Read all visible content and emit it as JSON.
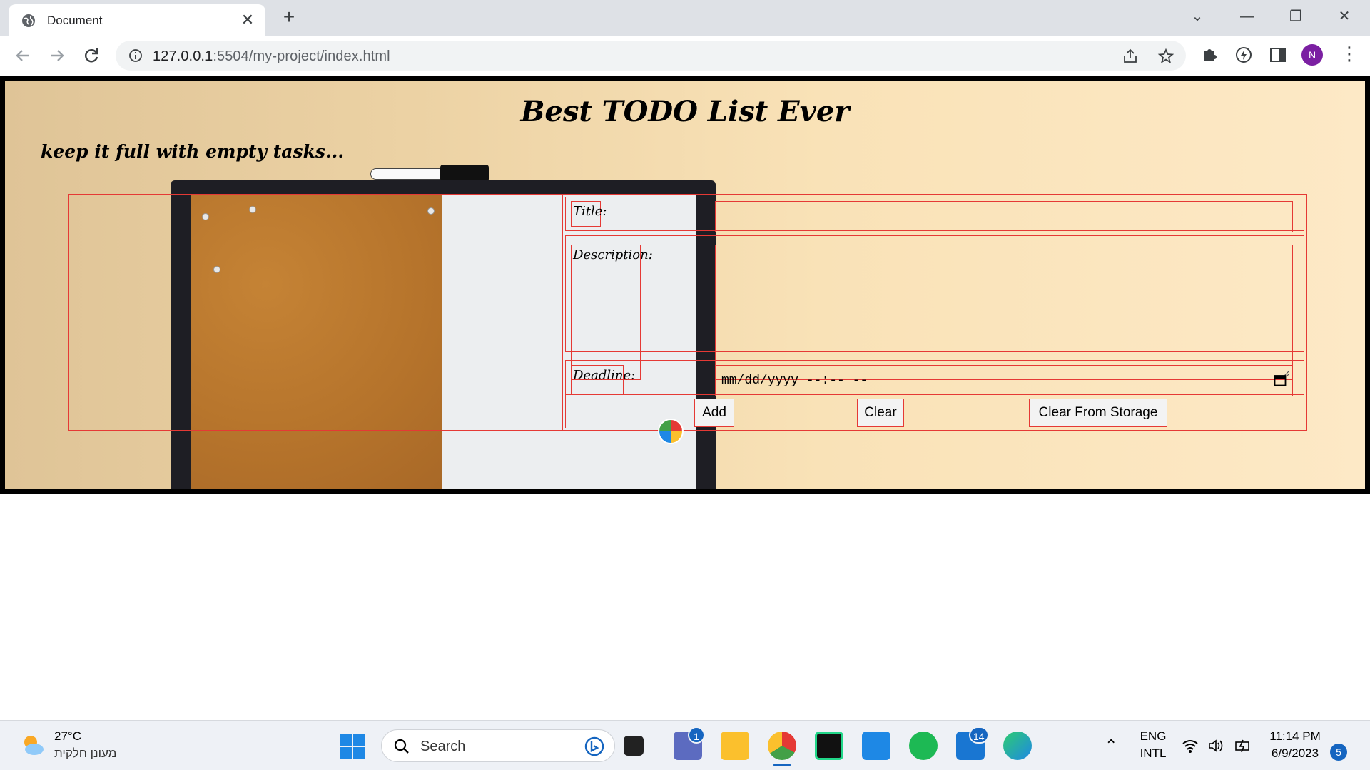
{
  "browser": {
    "tab_title": "Document",
    "url_host": "127.0.0.1",
    "url_path": ":5504/my-project/index.html",
    "profile_initial": "N"
  },
  "page": {
    "title": "Best TODO List Ever",
    "subtitle": "keep it full with empty tasks...",
    "form": {
      "title_label": "Title:",
      "description_label": "Description:",
      "deadline_label": "Deadline:",
      "deadline_placeholder": "mm/dd/yyyy --:-- --",
      "add_button": "Add",
      "clear_button": "Clear",
      "clear_storage_button": "Clear From Storage"
    }
  },
  "taskbar": {
    "weather_temp": "27°C",
    "weather_desc": "מעונן חלקית",
    "search_label": "Search",
    "teams_badge": "1",
    "app_badge": "14",
    "lang_top": "ENG",
    "lang_bottom": "INTL",
    "time": "11:14 PM",
    "date": "6/9/2023",
    "notifications": "5"
  },
  "colors": {
    "form_outline": "#e53935",
    "profile_avatar": "#7b1fa2"
  }
}
